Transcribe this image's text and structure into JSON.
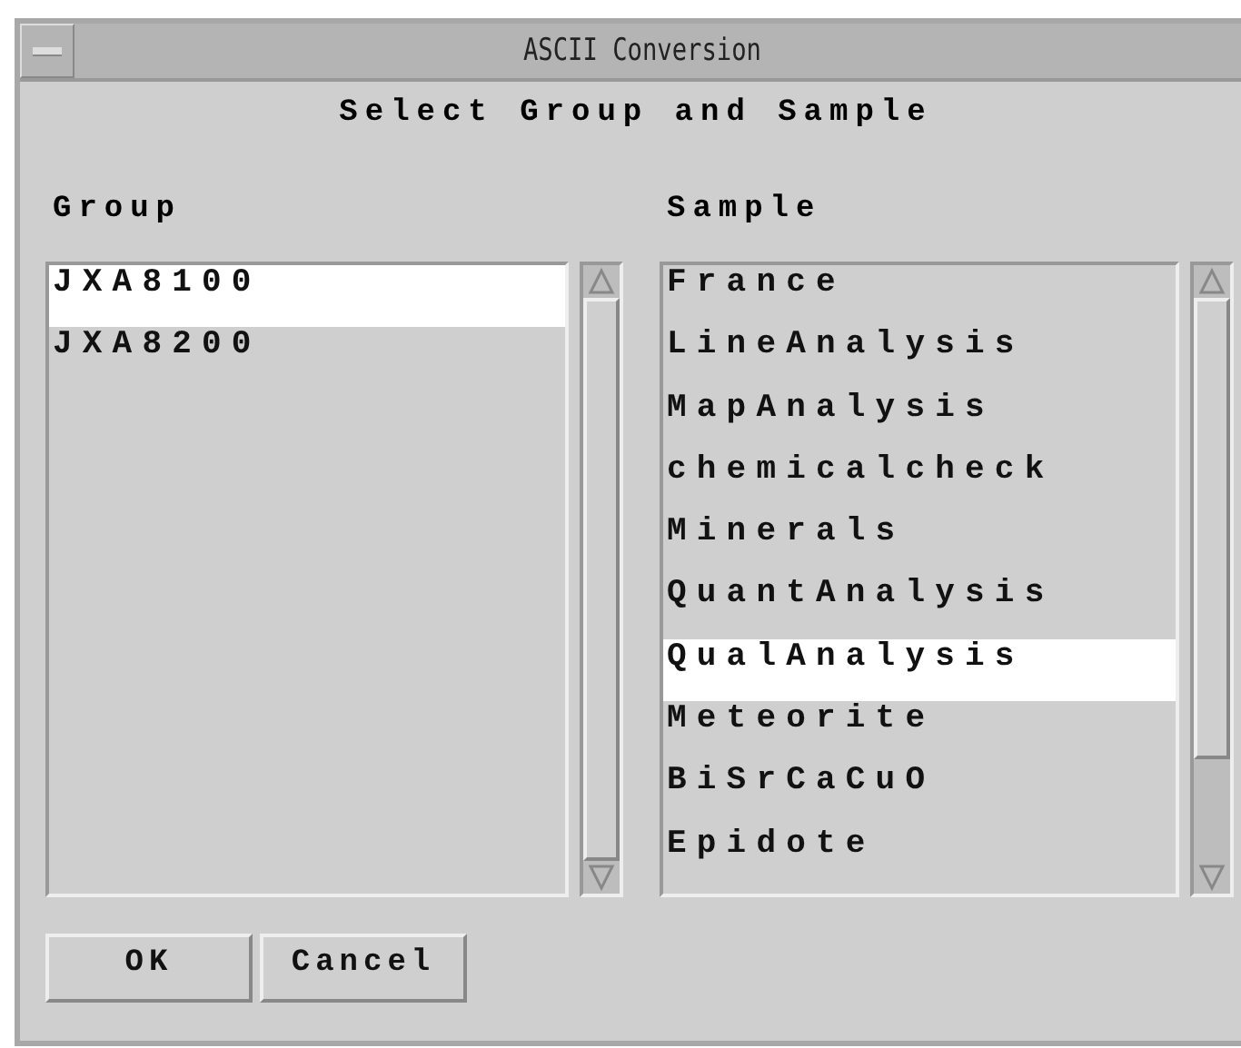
{
  "window": {
    "title": "ASCII Conversion"
  },
  "heading": "Select Group and Sample",
  "group": {
    "label": "Group",
    "items": [
      {
        "text": "JXA8100",
        "selected": true
      },
      {
        "text": "JXA8200",
        "selected": false
      }
    ]
  },
  "sample": {
    "label": "Sample",
    "items": [
      {
        "text": "France",
        "selected": false
      },
      {
        "text": "LineAnalysis",
        "selected": false
      },
      {
        "text": "MapAnalysis",
        "selected": false
      },
      {
        "text": "chemicalcheck",
        "selected": false
      },
      {
        "text": "Minerals",
        "selected": false
      },
      {
        "text": "QuantAnalysis",
        "selected": false
      },
      {
        "text": "QualAnalysis",
        "selected": true
      },
      {
        "text": "Meteorite",
        "selected": false
      },
      {
        "text": "BiSrCaCuO",
        "selected": false
      },
      {
        "text": "Epidote",
        "selected": false
      }
    ]
  },
  "buttons": [
    "OK",
    "Cancel"
  ]
}
